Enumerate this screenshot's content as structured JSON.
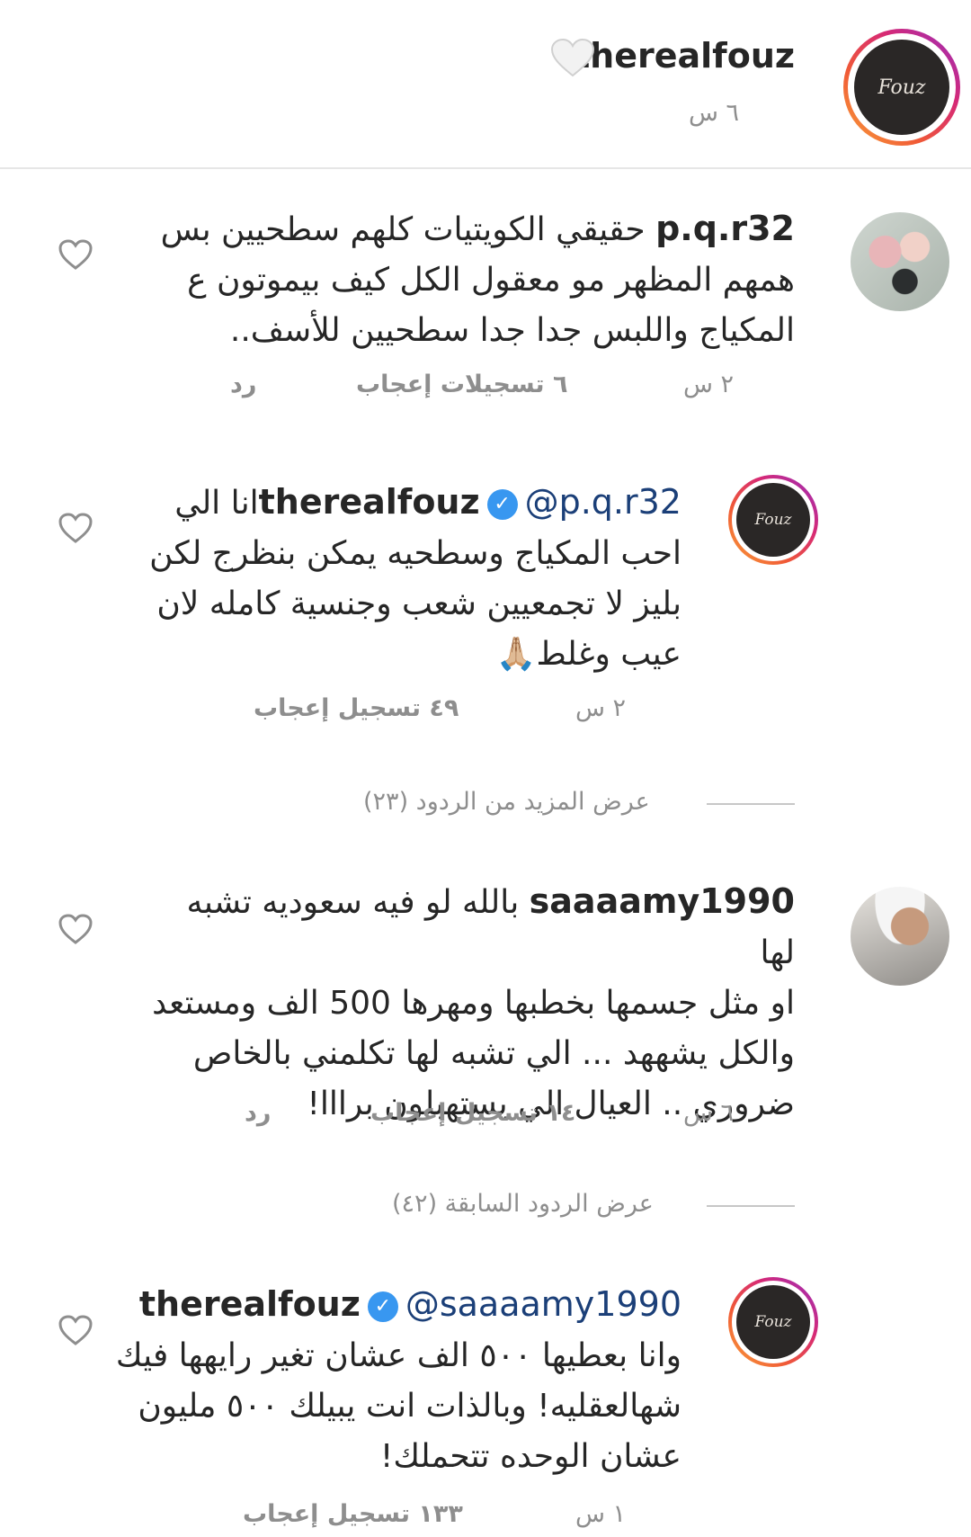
{
  "post": {
    "username": "therealfouz",
    "time": "٦ س",
    "avatar_text": "Fouz"
  },
  "comments": [
    {
      "username": "p.q.r32",
      "lines": [
        "حقيقي الكويتيات كلهم سطحيين بس",
        "همهم المظهر مو معقول الكل كيف بيموتون ع",
        "المكياج واللبس جدا جدا سطحيين للأسف.."
      ],
      "time": "٢ س",
      "likes": "٦ تسجيلات إعجاب",
      "reply": "رد"
    },
    {
      "username": "therealfouz",
      "mention": "@p.q.r32",
      "lines": [
        "انا الي",
        "احب المكياج وسطحيه يمكن بنظرج لكن",
        "بليز لا تجمعيين شعب وجنسية كامله لان",
        "عيب وغلط🙏🏼"
      ],
      "time": "٢ س",
      "likes": "٤٩ تسجيل إعجاب"
    },
    {
      "view_more": "عرض المزيد من الردود (٢٣)"
    },
    {
      "username": "saaaamy1990",
      "lines": [
        "بالله لو فيه سعوديه تشبه لها",
        "او مثل جسمها بخطبها ومهرها 500 الف ومستعد",
        "والكل يشههد ... الي تشبه لها تكلمني بالخاص",
        "ضروري .. العيال الي يستهبلون برااا!"
      ],
      "time": "٦ س",
      "likes": "١٤ تسجيل إعجاب",
      "reply": "رد"
    },
    {
      "view_prev": "عرض الردود السابقة (٤٢)"
    },
    {
      "username": "therealfouz",
      "mention": "@saaaamy1990",
      "lines": [
        "وانا بعطيها ٥٠٠ الف عشان تغير رايهها فيك",
        "شهالعقليه! وبالذات انت يبيلك ٥٠٠ مليون",
        "عشان الوحده تتحملك!"
      ],
      "time": "١ س",
      "likes": "١٣٣ تسجيل إعجاب"
    }
  ]
}
